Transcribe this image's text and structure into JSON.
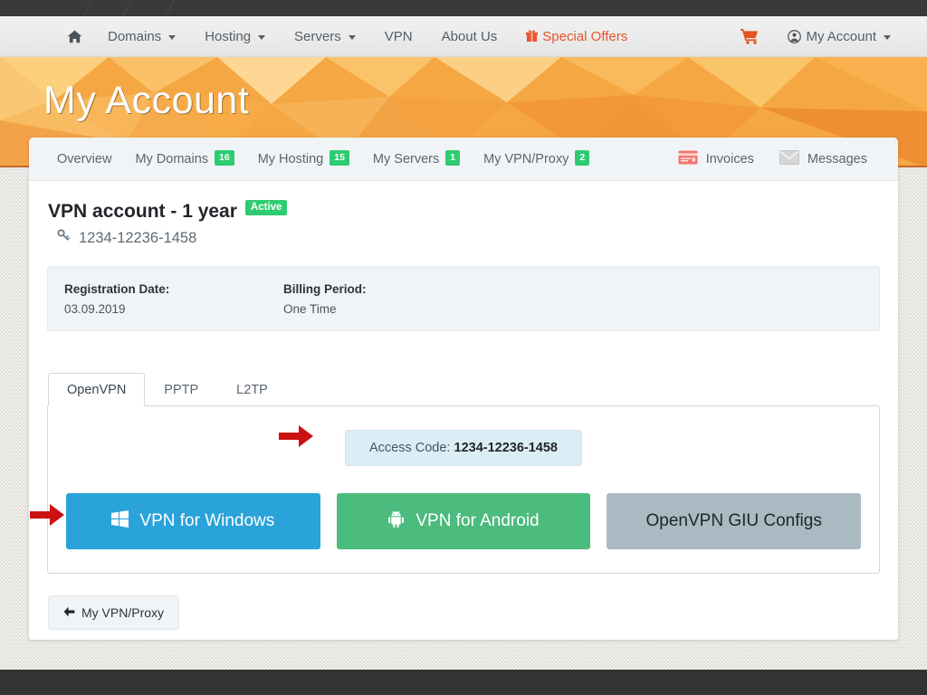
{
  "navbar": {
    "home_icon": "home-icon",
    "items": [
      {
        "label": "Domains",
        "has_caret": true
      },
      {
        "label": "Hosting",
        "has_caret": true
      },
      {
        "label": "Servers",
        "has_caret": true
      },
      {
        "label": "VPN",
        "has_caret": false
      },
      {
        "label": "About Us",
        "has_caret": false
      }
    ],
    "special_offers": "Special Offers",
    "special_offers_icon": "gift-icon",
    "special_offers_color": "#e8552d",
    "cart_icon": "shopping-cart-icon",
    "account_label": "My Account",
    "account_icon": "user-circle-icon"
  },
  "hero": {
    "title": "My Account"
  },
  "account_tabs": {
    "items": [
      {
        "label": "Overview",
        "badge": ""
      },
      {
        "label": "My Domains",
        "badge": "16"
      },
      {
        "label": "My Hosting",
        "badge": "15"
      },
      {
        "label": "My Servers",
        "badge": "1"
      },
      {
        "label": "My VPN/Proxy",
        "badge": "2"
      }
    ],
    "invoices_label": "Invoices",
    "invoices_icon": "credit-card-icon",
    "messages_label": "Messages",
    "messages_icon": "envelope-icon",
    "badge_color": "#2ecc71"
  },
  "service": {
    "title": "VPN account - 1 year",
    "status": "Active",
    "status_color": "#2ecc71",
    "id_icon": "key-icon",
    "id": "1234-12236-1458"
  },
  "info_panel": {
    "registration_label": "Registration Date:",
    "registration_value": "03.09.2019",
    "billing_label": "Billing Period:",
    "billing_value": "One Time"
  },
  "protocol_tabs": {
    "items": [
      "OpenVPN",
      "PPTP",
      "L2TP"
    ],
    "active": "OpenVPN"
  },
  "access": {
    "label": "Access Code:",
    "code": "1234-12236-1458",
    "box_color": "#dbeef6"
  },
  "download_buttons": [
    {
      "label": "VPN for Windows",
      "icon": "windows-logo-icon",
      "color": "#29a3d9"
    },
    {
      "label": "VPN for Android",
      "icon": "android-logo-icon",
      "color": "#4cbb7e"
    },
    {
      "label": "OpenVPN GIU Configs",
      "icon": "",
      "color": "#a9bac3"
    }
  ],
  "back_button": {
    "label": "My VPN/Proxy",
    "icon": "arrow-left-icon"
  },
  "annotations": {
    "arrow_color": "#cc1111",
    "arrows": [
      "access-code-arrow",
      "windows-button-arrow"
    ]
  }
}
